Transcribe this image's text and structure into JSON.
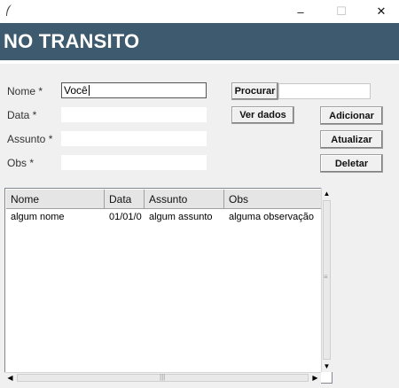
{
  "window": {
    "minimize_glyph": "–",
    "maximize_glyph": "☐",
    "close_glyph": "✕"
  },
  "header": {
    "title": "NO TRANSITO",
    "background_color": "#3d5a6e"
  },
  "form": {
    "nome_label": "Nome *",
    "nome_value": "Você",
    "data_label": "Data *",
    "data_value": "",
    "assunto_label": "Assunto *",
    "assunto_value": "",
    "obs_label": "Obs *",
    "obs_value": ""
  },
  "search": {
    "button_label": "Procurar",
    "value": ""
  },
  "actions": {
    "ver_dados_label": "Ver dados",
    "adicionar_label": "Adicionar",
    "atualizar_label": "Atualizar",
    "deletar_label": "Deletar"
  },
  "table": {
    "columns": [
      "Nome",
      "Data",
      "Assunto",
      "Obs"
    ],
    "rows": [
      [
        "algum nome",
        "01/01/0",
        "algum assunto",
        "alguma observação"
      ]
    ]
  }
}
